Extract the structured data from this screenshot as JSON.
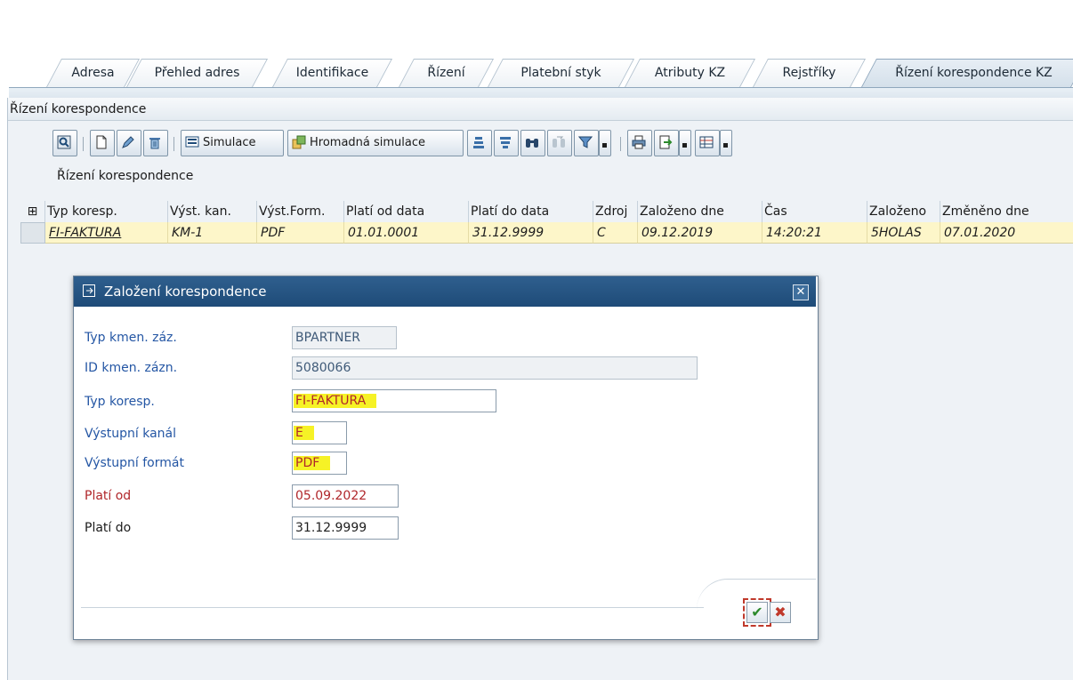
{
  "tabs": [
    {
      "label": "Adresa",
      "active": false
    },
    {
      "label": "Přehled adres",
      "active": false
    },
    {
      "label": "Identifikace",
      "active": false
    },
    {
      "label": "Řízení",
      "active": false
    },
    {
      "label": "Platební styk",
      "active": false
    },
    {
      "label": "Atributy KZ",
      "active": false
    },
    {
      "label": "Rejstříky",
      "active": false
    },
    {
      "label": "Řízení korespondence KZ",
      "active": true
    }
  ],
  "panel": {
    "title": "Řízení korespondence"
  },
  "toolbar": {
    "simulate_label": "Simulace",
    "mass_simulate_label": "Hromadná simulace"
  },
  "grid": {
    "caption": "Řízení korespondence",
    "columns": [
      "Typ koresp.",
      "Výst. kan.",
      "Výst.Form.",
      "Platí od data",
      "Platí do data",
      "Zdroj",
      "Založeno dne",
      "Čas",
      "Založeno",
      "Změněno dne"
    ],
    "rows": [
      [
        "FI-FAKTURA",
        "KM-1",
        "PDF",
        "01.01.0001",
        "31.12.9999",
        "C",
        "09.12.2019",
        "14:20:21",
        "5HOLAS",
        "07.01.2020"
      ]
    ]
  },
  "dialog": {
    "title": "Založení korespondence",
    "fields": {
      "typ_kmen_label": "Typ kmen. záz.",
      "typ_kmen_value": "BPARTNER",
      "id_kmen_label": "ID kmen. zázn.",
      "id_kmen_value": "5080066",
      "typ_koresp_label": "Typ koresp.",
      "typ_koresp_value": "FI-FAKTURA",
      "vystupni_kanal_label": "Výstupní kanál",
      "vystupni_kanal_value": "E",
      "vystupni_format_label": "Výstupní formát",
      "vystupni_format_value": "PDF",
      "plati_od_label": "Platí od",
      "plati_od_value": "05.09.2022",
      "plati_do_label": "Platí do",
      "plati_do_value": "31.12.9999"
    },
    "ok_icon": "checkmark-icon",
    "cancel_icon": "cross-icon"
  },
  "colors": {
    "title_bar": "#1e4b78",
    "highlight": "#f6f226",
    "required_label": "#b0262a",
    "field_label": "#2456a4",
    "row_bg": "#fdf6c9"
  }
}
